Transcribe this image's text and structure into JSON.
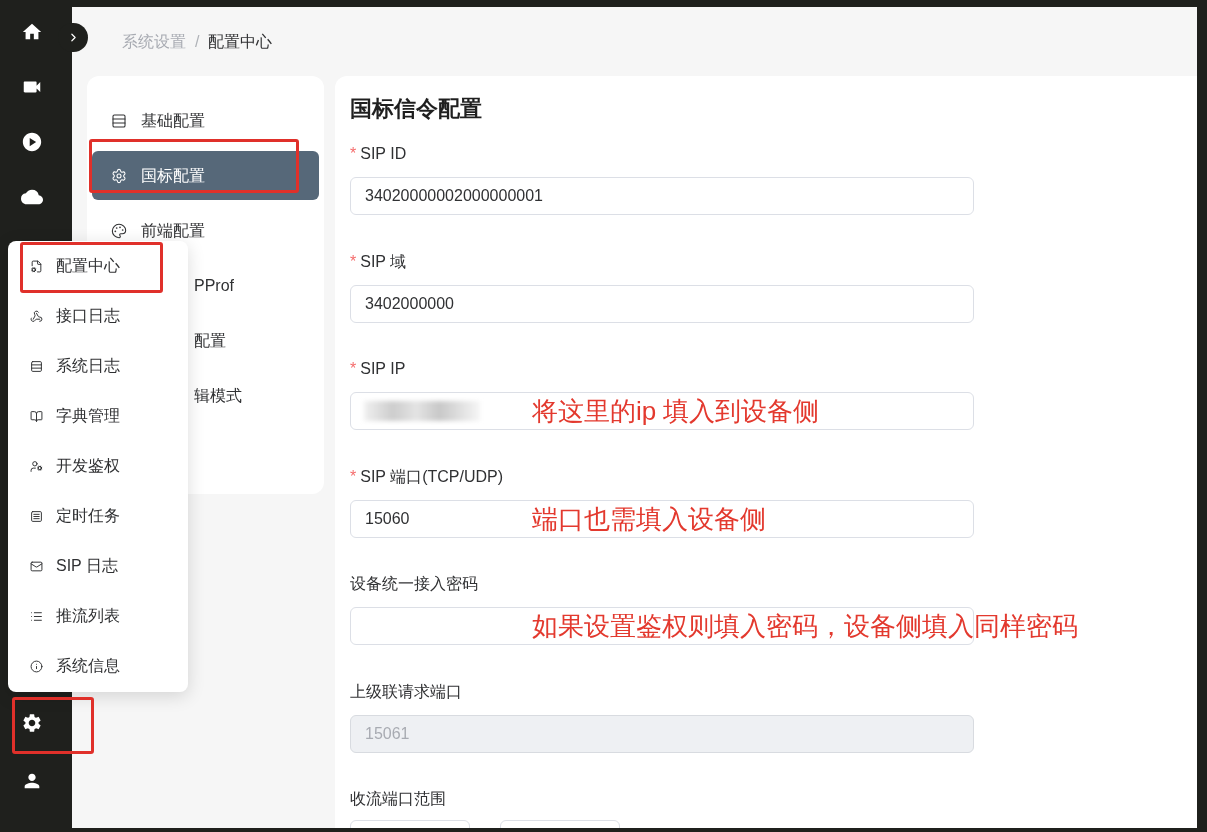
{
  "sidebar": {
    "top_items": [
      {
        "annotated": false
      },
      {
        "annotated": false
      },
      {
        "annotated": false
      },
      {
        "annotated": false
      }
    ],
    "bottom_items": [
      {
        "annotated": true
      },
      {
        "annotated": false
      }
    ]
  },
  "breadcrumb": {
    "separator": "/",
    "items": [
      {
        "label": "系统设置",
        "current": false
      },
      {
        "label": "配置中心",
        "current": true
      }
    ]
  },
  "config_menu": {
    "items": [
      {
        "kind": "item",
        "label": "基础配置",
        "selected": false,
        "annotated": false
      },
      {
        "kind": "item",
        "label": "国标配置",
        "selected": true,
        "annotated": true
      },
      {
        "kind": "item",
        "label": "前端配置",
        "selected": false,
        "annotated": false
      },
      {
        "kind": "covered",
        "label": "PProf",
        "selected": false,
        "annotated": false
      },
      {
        "kind": "covered",
        "label": "配置",
        "selected": false,
        "annotated": false
      },
      {
        "kind": "covered",
        "label": "辑模式",
        "selected": false,
        "annotated": false
      }
    ]
  },
  "form": {
    "title": "国标信令配置",
    "required_mark": "*",
    "fields": [
      {
        "kind": "text",
        "label": "SIP ID",
        "required": true,
        "value": "34020000002000000001",
        "disabled": false,
        "redacted": false
      },
      {
        "kind": "text",
        "label": "SIP 域",
        "required": true,
        "value": "3402000000",
        "disabled": false,
        "redacted": false
      },
      {
        "kind": "text",
        "label": "SIP IP",
        "required": true,
        "disabled": false,
        "redacted": true,
        "annotation": "将这里的ip 填入到设备侧"
      },
      {
        "kind": "text",
        "label": "SIP 端口(TCP/UDP)",
        "required": true,
        "value": "15060",
        "disabled": false,
        "redacted": false,
        "annotation": "端口也需填入设备侧"
      },
      {
        "kind": "text",
        "label": "设备统一接入密码",
        "required": false,
        "disabled": false,
        "redacted": false,
        "annotation": "如果设置鉴权则填入密码，设备侧填入同样密码"
      },
      {
        "kind": "text",
        "label": "上级联请求端口",
        "required": false,
        "value": "15061",
        "disabled": true,
        "redacted": false
      },
      {
        "kind": "range",
        "label": "收流端口范围",
        "required": false
      }
    ]
  },
  "popup_menu": {
    "open": true,
    "items": [
      {
        "label": "配置中心",
        "annotated": true
      },
      {
        "label": "接口日志",
        "annotated": false
      },
      {
        "label": "系统日志",
        "annotated": false
      },
      {
        "label": "字典管理",
        "annotated": false
      },
      {
        "label": "开发鉴权",
        "annotated": false
      },
      {
        "label": "定时任务",
        "annotated": false
      },
      {
        "label": "SIP 日志",
        "annotated": false
      },
      {
        "label": "推流列表",
        "annotated": false
      },
      {
        "label": "系统信息",
        "annotated": false
      }
    ]
  }
}
